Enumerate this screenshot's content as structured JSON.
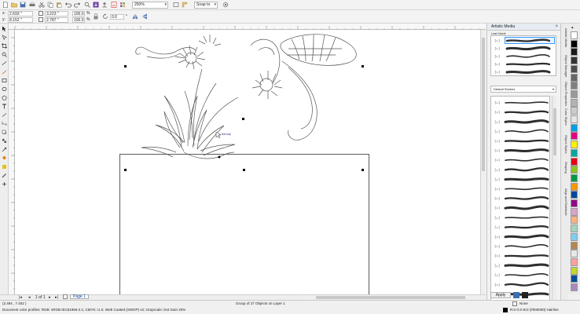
{
  "toolbar": {
    "zoom": "250%",
    "snap_to": "Snap to"
  },
  "property_bar": {
    "x": "2.693 \"",
    "y": "8.152 \"",
    "width": "3.223 \"",
    "height": "2.787 \"",
    "scale_w": "100.0",
    "scale_h": "100.0",
    "percent": "%",
    "angle": "0.0",
    "degree": "°"
  },
  "canvas": {
    "hover_label": "bitmap"
  },
  "docker": {
    "title": "Artistic Media",
    "last_used_label": "Last Used:",
    "category": "Default Strokes",
    "apply_label": "Apply",
    "stroke_row_label": "[=]",
    "stroke_count": 22,
    "tabs": [
      "Artistic Media",
      "Object Manager",
      "Object Properties",
      "Color Styles",
      "Object Styles",
      "Shaping",
      "Align and Distribute"
    ]
  },
  "palette": {
    "colors": [
      "#ffffff",
      "#000000",
      "#1a1a1a",
      "#333333",
      "#4d4d4d",
      "#666666",
      "#808080",
      "#999999",
      "#b3b3b3",
      "#cccccc",
      "#e6e6e6",
      "#00a0e9",
      "#e4007f",
      "#fff100",
      "#00a99d",
      "#e60012",
      "#8fc31f",
      "#009944",
      "#f39800",
      "#00479d",
      "#920783",
      "#d7a4c8",
      "#f6b37f",
      "#a4d5bd",
      "#7ecef4",
      "#b28850",
      "#e8e8e8",
      "#ff9fa0",
      "#c1d82f",
      "#004d9a",
      "#aa89bd"
    ]
  },
  "page_nav": {
    "position": "1 of 1",
    "tab": "Page 1"
  },
  "status": {
    "cursor": "(2.494 , 7.402 )",
    "selection": "Group of 27 Objects on Layer 1",
    "profiles": "Document color profiles: RGB: sRGB IEC61966-2.1; CMYK: U.S. Web Coated (SWOP) v2; Grayscale: Dot Gain 20%",
    "fill_name": "None",
    "outline_name": "R:0 G:0 B:0 (#000000)  Hairline"
  }
}
